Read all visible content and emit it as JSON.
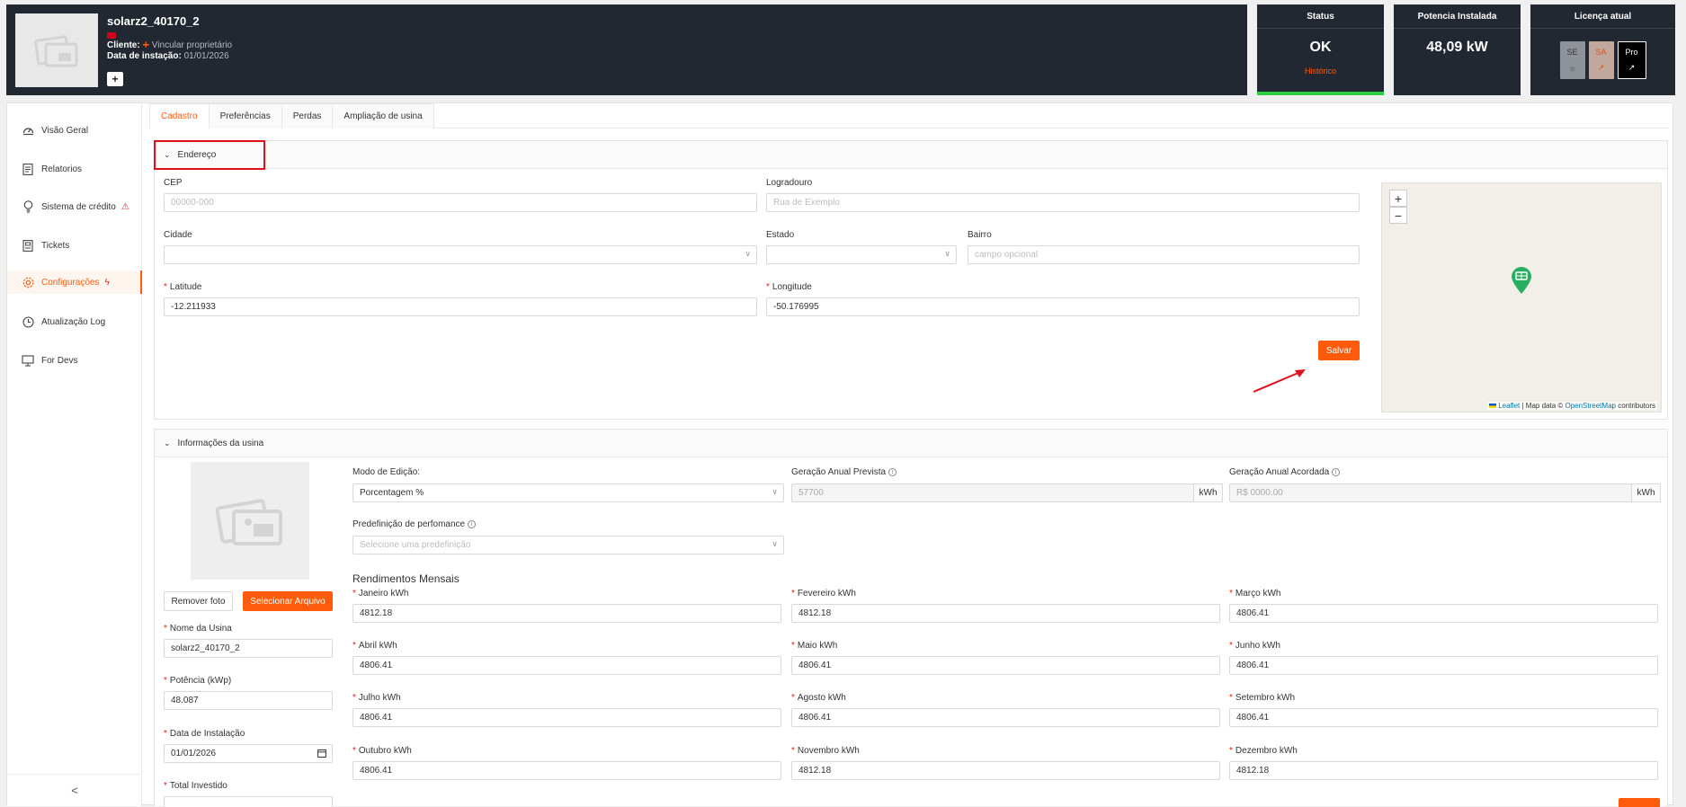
{
  "header": {
    "plant_name": "solarz2_40170_2",
    "client_label": "Cliente:",
    "client_link": "Vincular proprietário",
    "install_label": "Data de instação:",
    "install_date": "01/01/2026",
    "add_icon": "+"
  },
  "status_card": {
    "title": "Status",
    "value": "OK",
    "link": "Histórico"
  },
  "power_card": {
    "title": "Potencia Instalada",
    "value": "48,09 kW"
  },
  "license_card": {
    "title": "Licença atual",
    "items": [
      "SE",
      "SA",
      "Pro"
    ]
  },
  "sidebar": {
    "items": [
      {
        "label": "Visão Geral",
        "icon": "dashboard-icon"
      },
      {
        "label": "Relatorios",
        "icon": "report-icon"
      },
      {
        "label": "Sistema de crédito",
        "icon": "bulb-icon"
      },
      {
        "label": "Tickets",
        "icon": "ticket-icon"
      },
      {
        "label": "Configurações",
        "icon": "gear-icon"
      },
      {
        "label": "Atualização Log",
        "icon": "clock-icon"
      },
      {
        "label": "For Devs",
        "icon": "monitor-icon"
      }
    ],
    "collapse": "<"
  },
  "tabs": [
    "Cadastro",
    "Preferências",
    "Perdas",
    "Ampliação de usina"
  ],
  "address": {
    "title": "Endereço",
    "cep_label": "CEP",
    "cep_placeholder": "00000-000",
    "street_label": "Logradouro",
    "street_placeholder": "Rua de Exemplo",
    "city_label": "Cidade",
    "state_label": "Estado",
    "district_label": "Bairro",
    "district_placeholder": "campo opcional",
    "lat_label": "Latitude",
    "lat_value": "-12.211933",
    "lng_label": "Longitude",
    "lng_value": "-50.176995",
    "save": "Salvar",
    "map": {
      "zoom_in": "+",
      "zoom_out": "−",
      "attr_leaflet": "Leaflet",
      "attr_sep": " | Map data © ",
      "attr_osm": "OpenStreetMap",
      "attr_tail": " contributors"
    }
  },
  "plant_info": {
    "title": "Informações da usina",
    "remove_photo": "Remover foto",
    "select_file": "Selecionar Arquivo",
    "name_label": "Nome da Usina",
    "name_value": "solarz2_40170_2",
    "power_label": "Potência (kWp)",
    "power_value": "48.087",
    "date_label": "Data de Instalação",
    "date_value": "01/01/2026",
    "invest_label": "Total Investido",
    "edit_mode_label": "Modo de Edição:",
    "edit_mode_value": "Porcentagem %",
    "gen_forecast_label": "Geração Anual Prevista",
    "gen_forecast_value": "57700",
    "gen_agreed_label": "Geração Anual Acordada",
    "gen_agreed_value": "R$ 0000.00",
    "unit": "kWh",
    "preset_label": "Predefinição de perfomance",
    "preset_placeholder": "Selecione uma predefinição",
    "monthly_title": "Rendimentos Mensais",
    "months": [
      {
        "label": "Janeiro kWh",
        "value": "4812.18"
      },
      {
        "label": "Fevereiro kWh",
        "value": "4812.18"
      },
      {
        "label": "Março kWh",
        "value": "4806.41"
      },
      {
        "label": "Abril kWh",
        "value": "4806.41"
      },
      {
        "label": "Maio kWh",
        "value": "4806.41"
      },
      {
        "label": "Junho kWh",
        "value": "4806.41"
      },
      {
        "label": "Julho kWh",
        "value": "4806.41"
      },
      {
        "label": "Agosto kWh",
        "value": "4806.41"
      },
      {
        "label": "Setembro kWh",
        "value": "4806.41"
      },
      {
        "label": "Outubro kWh",
        "value": "4806.41"
      },
      {
        "label": "Novembro kWh",
        "value": "4812.18"
      },
      {
        "label": "Dezembro kWh",
        "value": "4812.18"
      }
    ]
  },
  "colors": {
    "accent": "#ff5b0a",
    "header_bg": "#222831",
    "status_ok": "#2ecc40",
    "highlight": "#e0101a"
  }
}
